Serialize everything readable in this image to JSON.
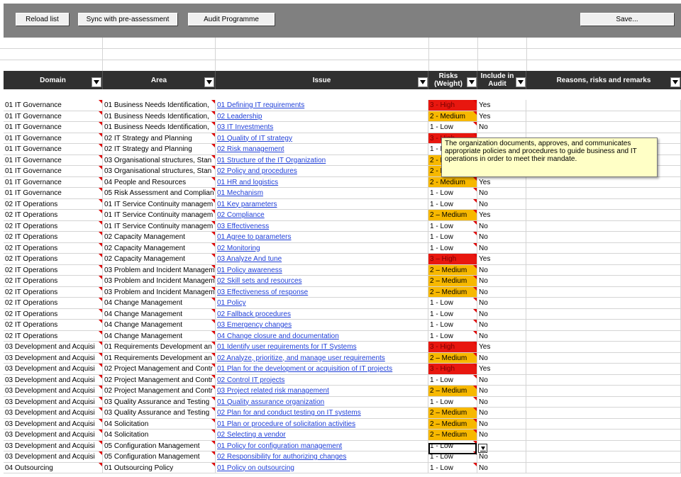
{
  "toolbar": {
    "reload_label": "Reload list",
    "sync_label": "Sync with pre-assessment",
    "audit_label": "Audit Programme",
    "save_label": "Save..."
  },
  "columns": {
    "domain": "Domain",
    "area": "Area",
    "issue": "Issue",
    "risks_line1": "Risks",
    "risks_line2": "(Weight)",
    "include_line1": "Include in",
    "include_line2": "Audit",
    "remarks": "Reasons, risks and remarks"
  },
  "colors": {
    "high": "#e8170f",
    "medium": "#f7b800",
    "link": "#1f3fd8",
    "header_bg": "#303030"
  },
  "tooltip": "The organization documents, approves, and communicates appropriate policies and procedures to guide business and IT operations in order to meet their mandate.",
  "rows": [
    {
      "domain": "01 IT Governance",
      "area": "01 Business Needs Identification,",
      "issue": "01 Defining IT requirements",
      "risk": "3 - High",
      "level": "high",
      "include": "Yes"
    },
    {
      "domain": "01 IT Governance",
      "area": "01 Business Needs Identification,",
      "issue": "02 Leadership",
      "risk": "2 - Medium",
      "level": "medium",
      "include": "Yes"
    },
    {
      "domain": "01 IT Governance",
      "area": "01 Business Needs Identification,",
      "issue": "03 IT Investments",
      "risk": "1 - Low",
      "level": "low",
      "include": "No"
    },
    {
      "domain": "01 IT Governance",
      "area": "02 IT Strategy and Planning",
      "issue": "01 Quality of IT strategy",
      "risk": "3 - High",
      "level": "high",
      "include": ""
    },
    {
      "domain": "01 IT Governance",
      "area": "02 IT Strategy and Planning",
      "issue": "02 Risk management",
      "risk": "1 - Low",
      "level": "low",
      "include": ""
    },
    {
      "domain": "01 IT Governance",
      "area": "03 Organisational structures, Stan",
      "issue": "01 Structure of the IT Organization",
      "risk": "2 - Medium",
      "level": "medium",
      "include": ""
    },
    {
      "domain": "01 IT Governance",
      "area": "03 Organisational structures, Stan",
      "issue": "02 Policy and procedures",
      "risk": "2 - Medium",
      "level": "medium",
      "include": ""
    },
    {
      "domain": "01 IT Governance",
      "area": "04 People and Resources",
      "issue": "01 HR and logistics",
      "risk": "2 - Medium",
      "level": "medium",
      "include": "Yes"
    },
    {
      "domain": "01 IT Governance",
      "area": "05 Risk Assessment and Complian",
      "issue": "01 Mechanism",
      "risk": "1 - Low",
      "level": "low",
      "include": "No"
    },
    {
      "domain": "02 IT Operations",
      "area": "01 IT Service Continuity managem",
      "issue": "01 Key parameters",
      "risk": "1 - Low",
      "level": "low",
      "include": "No"
    },
    {
      "domain": "02 IT Operations",
      "area": "01 IT Service Continuity managem",
      "issue": "02 Compliance",
      "risk": "2 – Medium",
      "level": "medium",
      "include": "Yes"
    },
    {
      "domain": "02 IT Operations",
      "area": "01 IT Service Continuity managem",
      "issue": "03 Effectiveness",
      "risk": "1 - Low",
      "level": "low",
      "include": "No"
    },
    {
      "domain": "02 IT Operations",
      "area": "02 Capacity Management",
      "issue": "01 Agree to parameters",
      "risk": "1 - Low",
      "level": "low",
      "include": "No"
    },
    {
      "domain": "02 IT Operations",
      "area": "02 Capacity Management",
      "issue": "02 Monitoring",
      "risk": "1 - Low",
      "level": "low",
      "include": "No"
    },
    {
      "domain": "02 IT Operations",
      "area": "02 Capacity Management",
      "issue": "03 Analyze And tune",
      "risk": "3 – High",
      "level": "high",
      "include": "Yes"
    },
    {
      "domain": "02 IT Operations",
      "area": "03 Problem and Incident Managem",
      "issue": "01 Policy awareness",
      "risk": "2 – Medium",
      "level": "medium",
      "include": "No"
    },
    {
      "domain": "02 IT Operations",
      "area": "03 Problem and Incident Managem",
      "issue": "02 Skill sets and resources",
      "risk": "2 – Medium",
      "level": "medium",
      "include": "No"
    },
    {
      "domain": "02 IT Operations",
      "area": "03 Problem and Incident Managem",
      "issue": "03 Effectiveness of response",
      "risk": "2 – Medium",
      "level": "medium",
      "include": "No"
    },
    {
      "domain": "02 IT Operations",
      "area": "04 Change Management",
      "issue": "01 Policy",
      "risk": "1 - Low",
      "level": "low",
      "include": "No"
    },
    {
      "domain": "02 IT Operations",
      "area": "04 Change Management",
      "issue": "02 Fallback procedures",
      "risk": "1 - Low",
      "level": "low",
      "include": "No"
    },
    {
      "domain": "02 IT Operations",
      "area": "04 Change Management",
      "issue": "03 Emergency changes",
      "risk": "1 - Low",
      "level": "low",
      "include": "No"
    },
    {
      "domain": "02 IT Operations",
      "area": "04 Change Management",
      "issue": "04 Change closure and documentation",
      "risk": "1 - Low",
      "level": "low",
      "include": "No"
    },
    {
      "domain": "03 Development and Acquisi",
      "area": "01 Requirements Development an",
      "issue": "01 Identify user requirements for IT Systems",
      "risk": "3 - High",
      "level": "high",
      "include": "Yes"
    },
    {
      "domain": "03 Development and Acquisi",
      "area": "01 Requirements Development an",
      "issue": "02 Analyze, prioritize, and manage user requirements",
      "risk": "2 – Medium",
      "level": "medium",
      "include": "No"
    },
    {
      "domain": "03 Development and Acquisi",
      "area": "02 Project Management and Contr",
      "issue": "01 Plan for the development or acquisition of IT projects",
      "risk": "3 - High",
      "level": "high",
      "include": "Yes"
    },
    {
      "domain": "03 Development and Acquisi",
      "area": "02 Project Management and Contr",
      "issue": "02 Control IT projects",
      "risk": "1 - Low",
      "level": "low",
      "include": "No"
    },
    {
      "domain": "03 Development and Acquisi",
      "area": "02 Project Management and Contr",
      "issue": "03 Project related risk management",
      "risk": "2 – Medium",
      "level": "medium",
      "include": "No"
    },
    {
      "domain": "03 Development and Acquisi",
      "area": "03 Quality Assurance and Testing",
      "issue": "01 Quality assurance organization",
      "risk": "1 - Low",
      "level": "low",
      "include": "No"
    },
    {
      "domain": "03 Development and Acquisi",
      "area": "03 Quality Assurance and Testing",
      "issue": "02 Plan for and conduct testing on IT systems",
      "risk": "2 – Medium",
      "level": "medium",
      "include": "No"
    },
    {
      "domain": "03 Development and Acquisi",
      "area": "04 Solicitation",
      "issue": "01 Plan or procedure of solicitation activities",
      "risk": "2 – Medium",
      "level": "medium",
      "include": "No"
    },
    {
      "domain": "03 Development and Acquisi",
      "area": "04 Solicitation",
      "issue": "02 Selecting a vendor",
      "risk": "2 – Medium",
      "level": "medium",
      "include": "No"
    },
    {
      "domain": "03 Development and Acquisi",
      "area": "05 Configuration Management",
      "issue": "01 Policy for configuration management",
      "risk": "1 - Low",
      "level": "low",
      "include": ""
    },
    {
      "domain": "03 Development and Acquisi",
      "area": "05 Configuration Management",
      "issue": "02 Responsibility for authorizing changes",
      "risk": "1 - Low",
      "level": "low",
      "include": "No"
    },
    {
      "domain": "04 Outsourcing",
      "area": "01 Outsourcing Policy",
      "issue": "01 Policy on outsourcing",
      "risk": "1 - Low",
      "level": "low",
      "include": "No"
    }
  ]
}
